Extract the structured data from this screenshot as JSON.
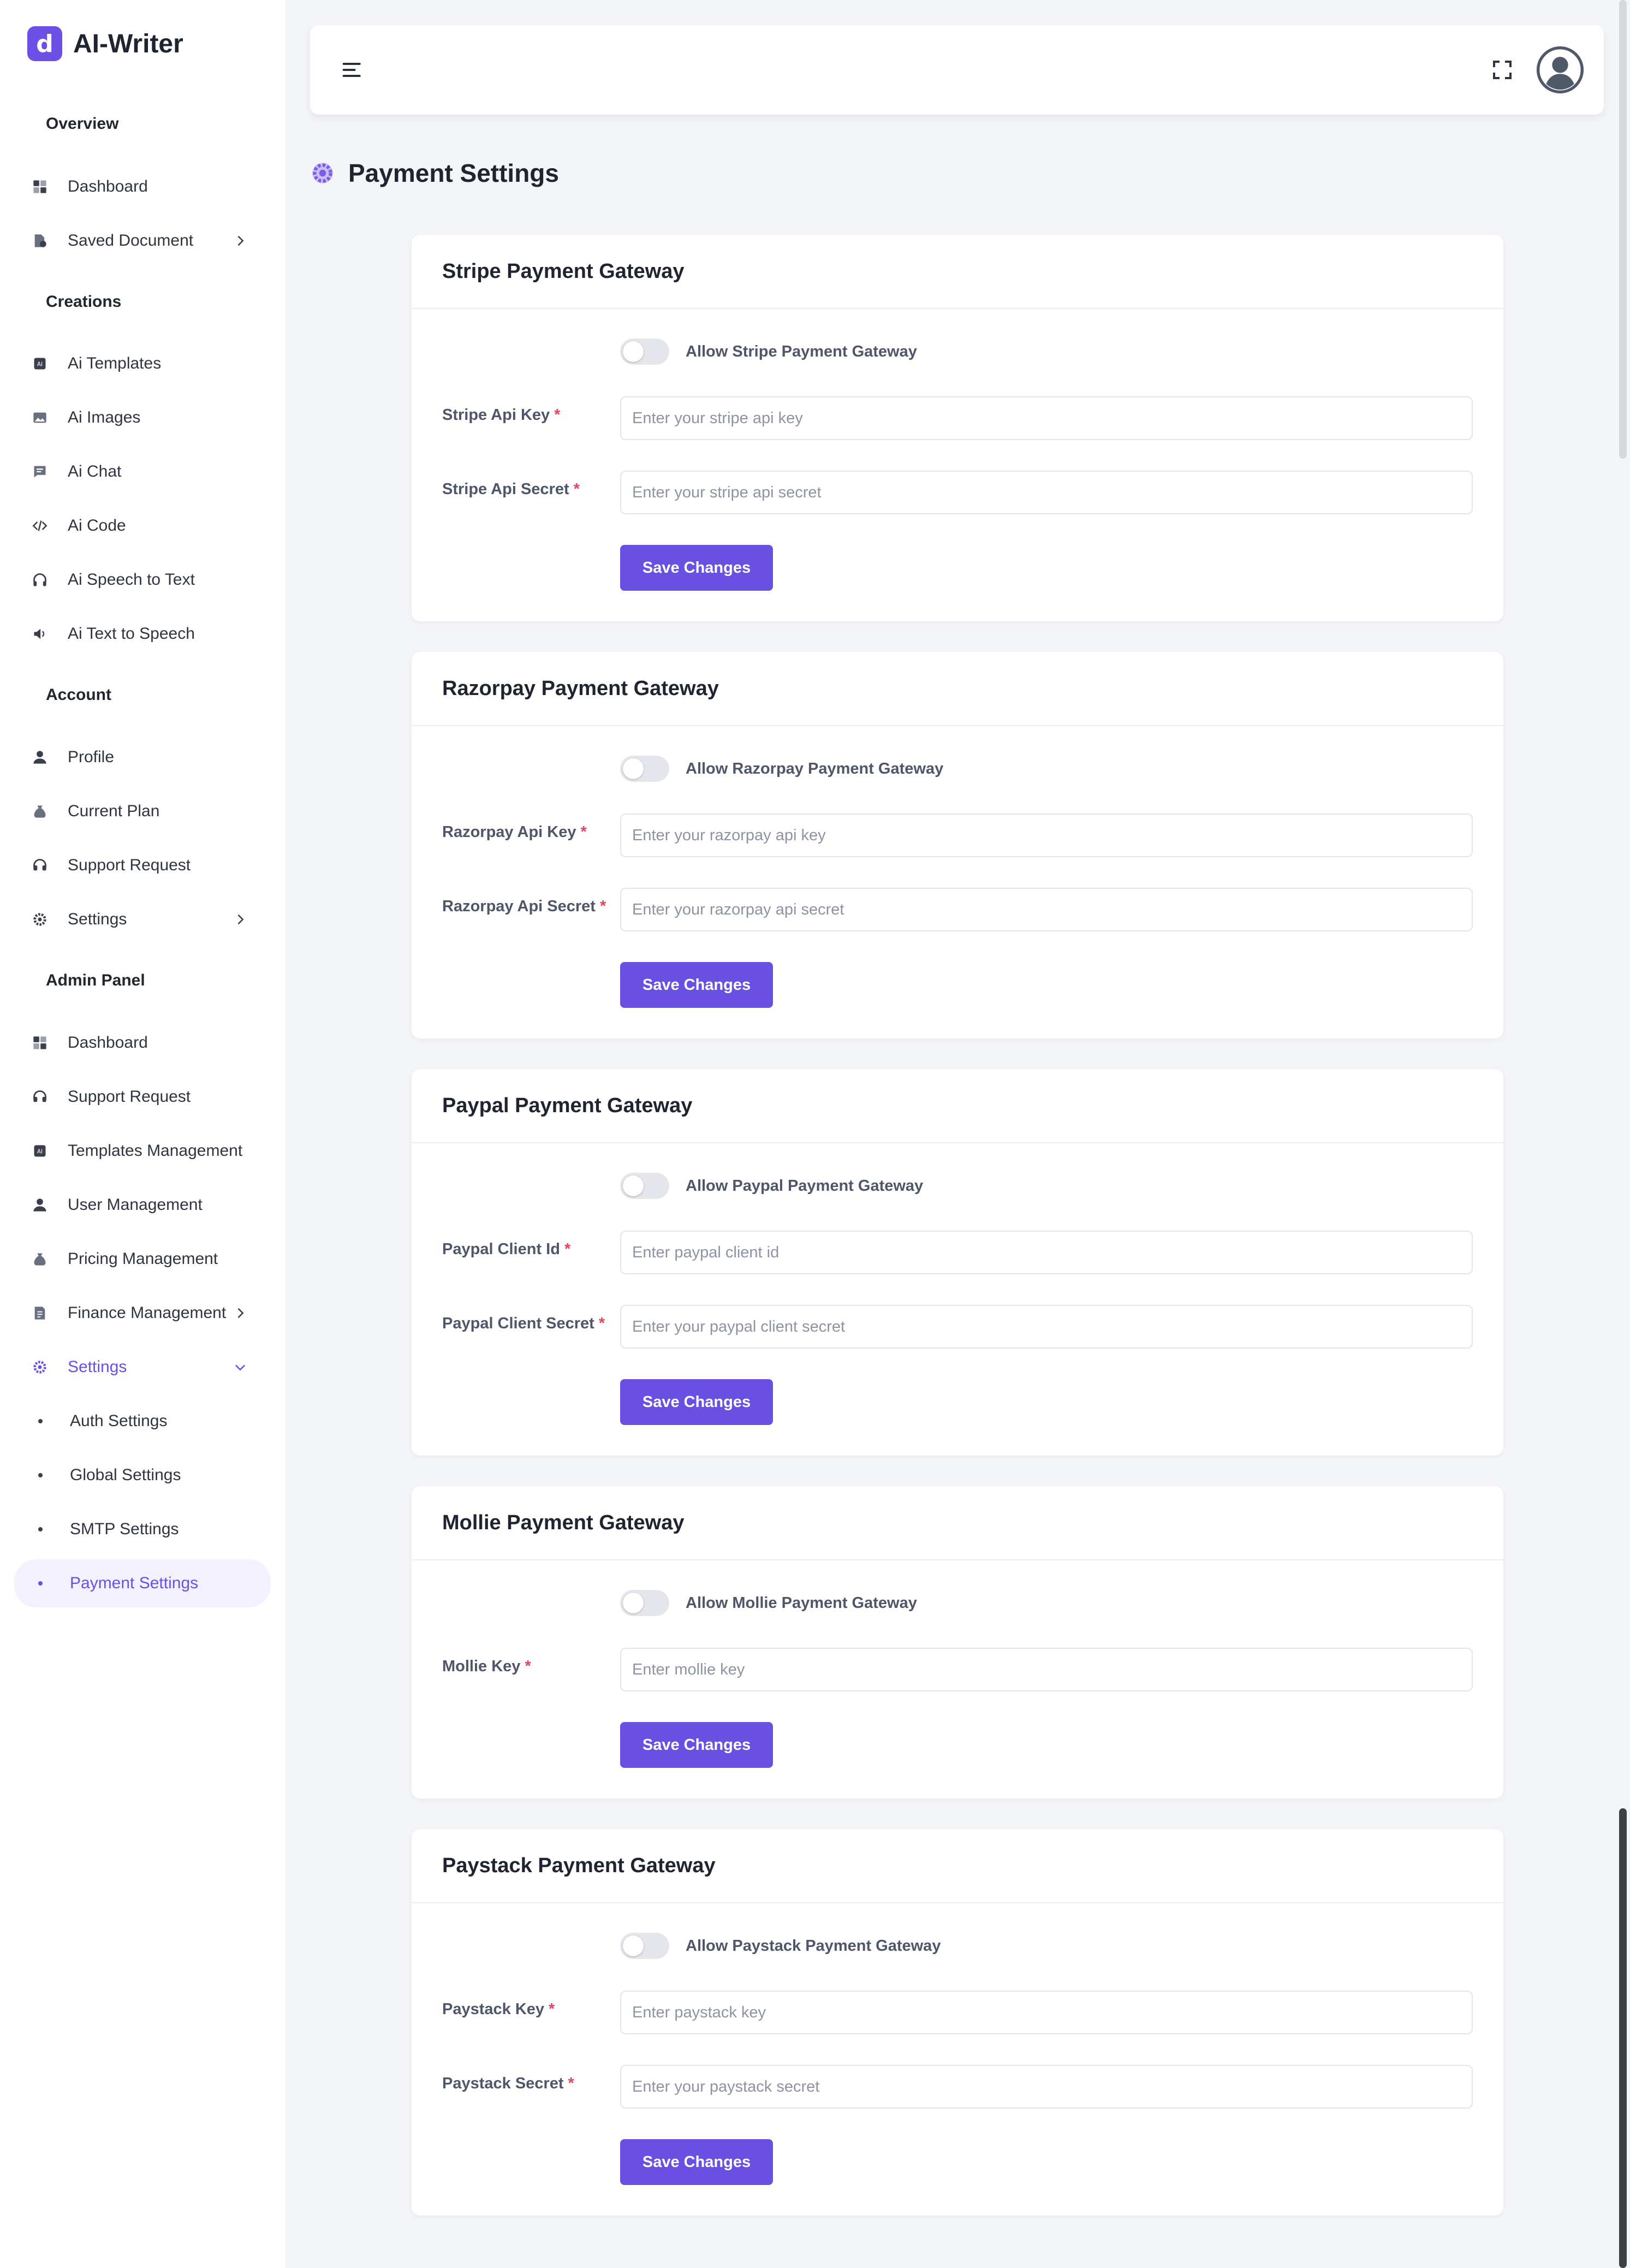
{
  "app": {
    "name": "AI-Writer",
    "logo_letter": "d"
  },
  "sidebar": {
    "sections": {
      "overview": "Overview",
      "creations": "Creations",
      "account": "Account",
      "admin": "Admin Panel"
    },
    "items": {
      "dashboard": "Dashboard",
      "saved_document": "Saved Document",
      "ai_templates": "Ai Templates",
      "ai_images": "Ai Images",
      "ai_chat": "Ai Chat",
      "ai_code": "Ai Code",
      "ai_speech_to_text": "Ai Speech to Text",
      "ai_text_to_speech": "Ai Text to Speech",
      "profile": "Profile",
      "current_plan": "Current Plan",
      "support_request": "Support Request",
      "settings": "Settings",
      "admin_dashboard": "Dashboard",
      "admin_support_request": "Support Request",
      "templates_management": "Templates Management",
      "user_management": "User Management",
      "pricing_management": "Pricing Management",
      "finance_management": "Finance Management",
      "admin_settings": "Settings",
      "auth_settings": "Auth Settings",
      "global_settings": "Global Settings",
      "smtp_settings": "SMTP Settings",
      "payment_settings": "Payment Settings"
    }
  },
  "page": {
    "title": "Payment Settings"
  },
  "cards": {
    "stripe": {
      "title": "Stripe Payment Gateway",
      "toggle_label": "Allow Stripe Payment Gateway",
      "field1_label": "Stripe Api Key",
      "field1_placeholder": "Enter your stripe api key",
      "field2_label": "Stripe Api Secret",
      "field2_placeholder": "Enter your stripe api secret",
      "save": "Save Changes"
    },
    "razorpay": {
      "title": "Razorpay Payment Gateway",
      "toggle_label": "Allow Razorpay Payment Gateway",
      "field1_label": "Razorpay Api Key",
      "field1_placeholder": "Enter your razorpay api key",
      "field2_label": "Razorpay Api Secret",
      "field2_placeholder": "Enter your razorpay api secret",
      "save": "Save Changes"
    },
    "paypal": {
      "title": "Paypal Payment Gateway",
      "toggle_label": "Allow Paypal Payment Gateway",
      "field1_label": "Paypal Client Id",
      "field1_placeholder": "Enter paypal client id",
      "field2_label": "Paypal Client Secret",
      "field2_placeholder": "Enter your paypal client secret",
      "save": "Save Changes"
    },
    "mollie": {
      "title": "Mollie Payment Gateway",
      "toggle_label": "Allow Mollie Payment Gateway",
      "field1_label": "Mollie Key",
      "field1_placeholder": "Enter mollie key",
      "save": "Save Changes"
    },
    "paystack": {
      "title": "Paystack Payment Gateway",
      "toggle_label": "Allow Paystack Payment Gateway",
      "field1_label": "Paystack Key",
      "field1_placeholder": "Enter paystack key",
      "field2_label": "Paystack Secret",
      "field2_placeholder": "Enter your paystack secret",
      "save": "Save Changes"
    }
  },
  "required_marker": "*",
  "colors": {
    "accent": "#6a4fe3",
    "required": "#e3445f"
  }
}
